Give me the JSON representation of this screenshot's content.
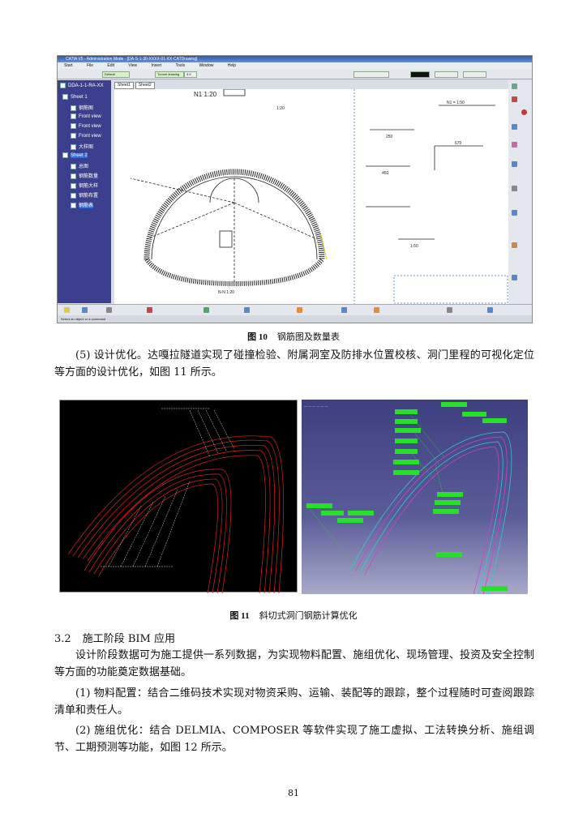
{
  "figure10": {
    "window_title": "CATIA V5 - Administration Mode - [DA-S-1-30-XXXX-01-XX-CATDrawing]",
    "menu": [
      "Start",
      "File",
      "Edit",
      "View",
      "Insert",
      "Tools",
      "Window",
      "Help"
    ],
    "toolbar_combo_1": "Default",
    "toolbar_combo_2": "Tunnel drawing",
    "toolbar_combo_3": "3.5",
    "sheet_tabs": [
      "Sheet1",
      "Sheet2"
    ],
    "tree": {
      "root": "DDA-1-1-RA-XX",
      "items": [
        {
          "label": "Sheet 1",
          "level": 0,
          "selected": false
        },
        {
          "label": "钢筋图",
          "level": 1,
          "selected": false
        },
        {
          "label": "Front view",
          "level": 1,
          "selected": false
        },
        {
          "label": "Front view",
          "level": 1,
          "selected": false
        },
        {
          "label": "Front view",
          "level": 1,
          "selected": false
        },
        {
          "label": "大样图",
          "level": 1,
          "selected": false
        },
        {
          "label": "Sheet 2",
          "level": 0,
          "selected": true
        },
        {
          "label": "总图",
          "level": 1,
          "selected": false
        },
        {
          "label": "钢筋数量",
          "level": 1,
          "selected": false
        },
        {
          "label": "钢筋大样",
          "level": 1,
          "selected": false
        },
        {
          "label": "钢筋布置",
          "level": 1,
          "selected": false
        },
        {
          "label": "钢筋表",
          "level": 1,
          "selected": true
        }
      ]
    },
    "drawing_labels": {
      "top": "N1 1:20",
      "detail_a": "1:20",
      "scale_bottom": "N-N 1:20",
      "table_title": "N1 = 1:50",
      "dim_1": "250",
      "dim_2": "450",
      "dim_3": "670",
      "dim_4": "1:50"
    },
    "status": "Select an object or a command",
    "caption_number": "图 10",
    "caption_text": "钢筋图及数量表"
  },
  "paragraph_5": "(5) 设计优化。达嘎拉隧道实现了碰撞检验、附属洞室及防排水位置校核、洞门里程的可视化定位等方面的设计优化，如图 11 所示。",
  "figure11": {
    "caption_number": "图 11",
    "caption_text": "斜切式洞门钢筋计算优化"
  },
  "section": {
    "number": "3.2",
    "title": "施工阶段 BIM 应用"
  },
  "paragraphs": [
    "设计阶段数据可为施工提供一系列数据，为实现物料配置、施组优化、现场管理、投资及安全控制等方面的功能奠定数据基础。",
    "(1) 物料配置：结合二维码技术实现对物资采购、运输、装配等的跟踪，整个过程随时可查阅跟踪清单和责任人。",
    "(2) 施组优化：结合 DELMIA、COMPOSER 等软件实现了施工虚拟、工法转换分析、施组调节、工期预测等功能，如图 12 所示。"
  ],
  "page_number": "81",
  "colors": {
    "tree_bg": "#3b3f8e",
    "rebar_red": "#d02020",
    "label_green": "#28e028",
    "viewport_bg": "#4a4c8c"
  }
}
